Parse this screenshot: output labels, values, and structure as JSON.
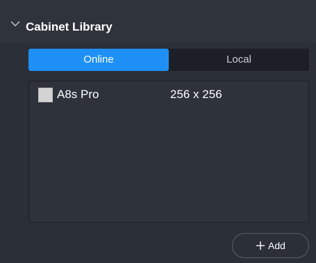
{
  "header": {
    "title": "Cabinet Library",
    "toggle_icon": "chevron-down-icon"
  },
  "tabs": [
    {
      "label": "Online",
      "active": true
    },
    {
      "label": "Local",
      "active": false
    }
  ],
  "cabinets": [
    {
      "name": "A8s Pro",
      "resolution": "256 x 256",
      "swatch_color": "#d3d3d3"
    }
  ],
  "add_button": {
    "label": "Add",
    "icon": "plus-icon"
  },
  "colors": {
    "accent": "#1e90f5",
    "background": "#2b2f38"
  }
}
